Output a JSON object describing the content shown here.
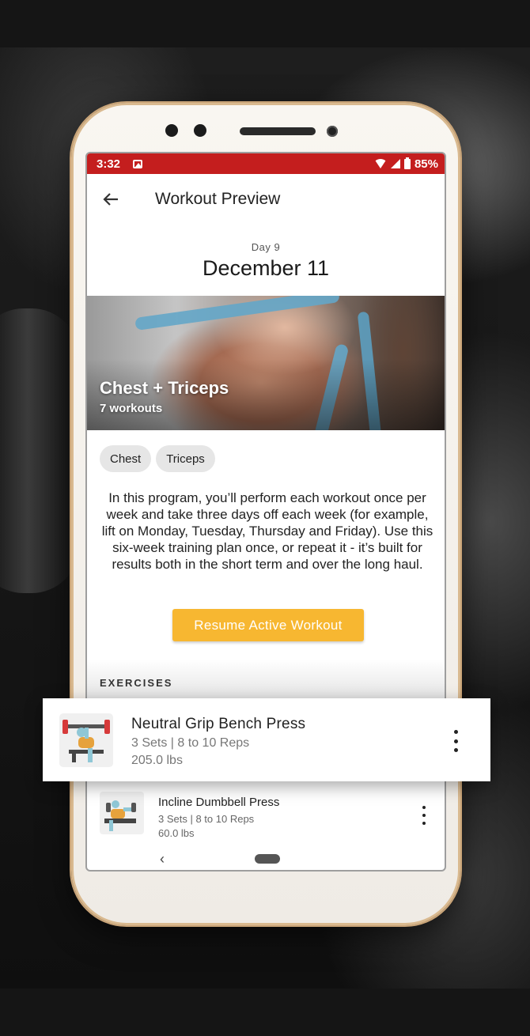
{
  "status_bar": {
    "time": "3:32",
    "battery": "85%"
  },
  "app_bar": {
    "title": "Workout Preview"
  },
  "day": {
    "label": "Day 9",
    "date": "December 11"
  },
  "hero": {
    "title": "Chest + Triceps",
    "subtitle": "7 workouts"
  },
  "tags": [
    "Chest",
    "Triceps"
  ],
  "description": "In this program, you’ll perform each workout once per week and take three days off each week (for example, lift on Monday, Tuesday, Thursday and Friday). Use this six-week training plan once, or repeat it - it’s built for results both in the short term and over the long haul.",
  "resume_button": "Resume Active Workout",
  "exercises_label": "EXERCISES",
  "exercises": [
    {
      "name": "Neutral Grip Bench Press",
      "meta": "3 Sets | 8 to 10 Reps",
      "weight": "205.0 lbs"
    },
    {
      "name": "Incline Dumbbell Press",
      "meta": "3 Sets | 8 to 10 Reps",
      "weight": "60.0 lbs"
    }
  ],
  "colors": {
    "status_bar": "#c41e1e",
    "accent_button": "#f7b731",
    "phone_trim": "#d9b98f"
  }
}
